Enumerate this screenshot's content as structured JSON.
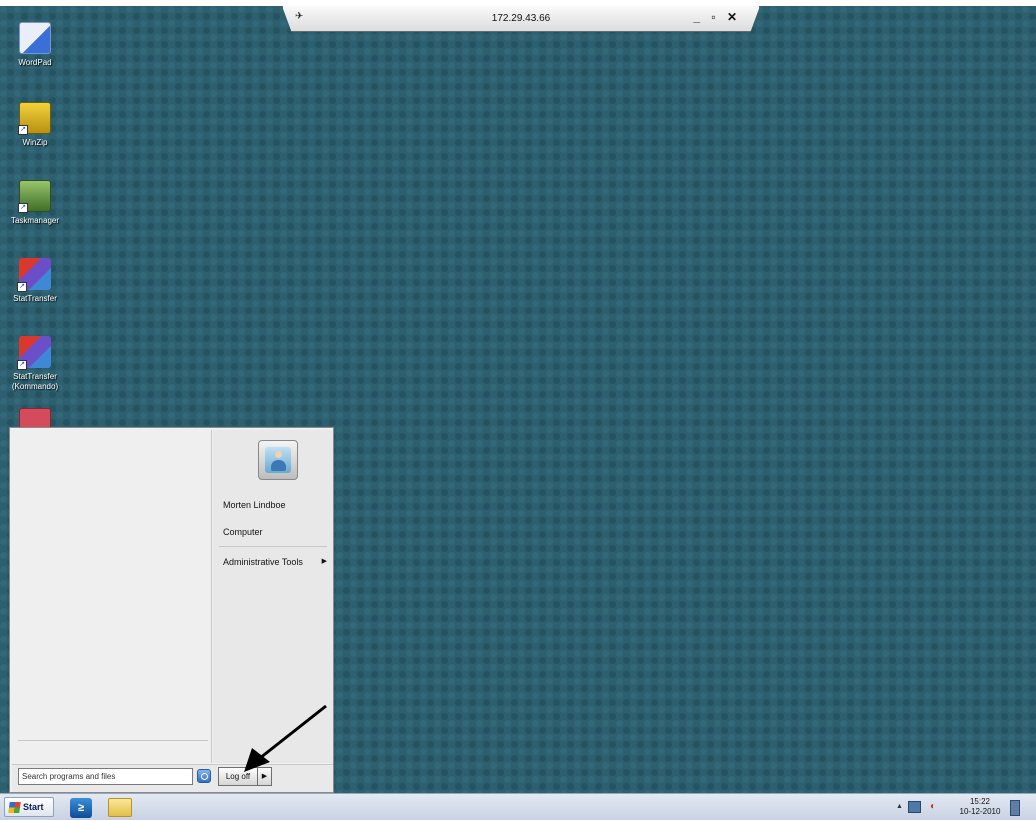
{
  "remote_session": {
    "title": "172.29.43.66",
    "controls": "_ ▫ ✕"
  },
  "desktop_icons": [
    {
      "label": "WordPad",
      "icon": "wordpad-icon"
    },
    {
      "label": "WinZip",
      "icon": "winzip-icon"
    },
    {
      "label": "Taskmanager",
      "icon": "taskmanager-icon"
    },
    {
      "label": "StatTransfer",
      "icon": "stattransfer-icon"
    },
    {
      "label": "StatTransfer (Kommando)",
      "icon": "stattransfer-command-icon"
    },
    {
      "label": "",
      "icon": "app-icon"
    }
  ],
  "start_menu": {
    "right_items": {
      "user": "Morten Lindboe",
      "computer": "Computer",
      "admin_tools": "Administrative Tools"
    },
    "search_placeholder": "Search programs and files",
    "logoff_label": "Log off"
  },
  "taskbar": {
    "start_label": "Start",
    "clock_time": "15:22",
    "clock_date": "10-12-2010"
  }
}
